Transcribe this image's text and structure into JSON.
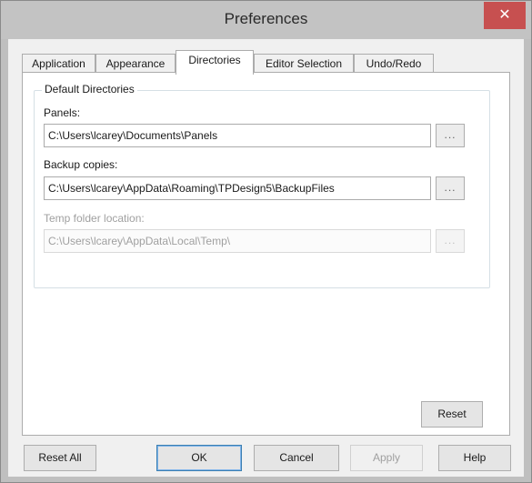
{
  "window": {
    "title": "Preferences"
  },
  "tabs": [
    {
      "label": "Application"
    },
    {
      "label": "Appearance"
    },
    {
      "label": "Directories"
    },
    {
      "label": "Editor Selection"
    },
    {
      "label": "Undo/Redo"
    }
  ],
  "active_tab": "Directories",
  "group": {
    "label": "Default Directories"
  },
  "fields": {
    "panels": {
      "label": "Panels:",
      "value": "C:\\Users\\lcarey\\Documents\\Panels",
      "browse": "..."
    },
    "backup": {
      "label": "Backup copies:",
      "value": "C:\\Users\\lcarey\\AppData\\Roaming\\TPDesign5\\BackupFiles",
      "browse": "..."
    },
    "temp": {
      "label": "Temp folder location:",
      "value": "C:\\Users\\lcarey\\AppData\\Local\\Temp\\",
      "browse": "...",
      "disabled": true
    }
  },
  "buttons": {
    "reset": "Reset",
    "reset_all": "Reset All",
    "ok": "OK",
    "cancel": "Cancel",
    "apply": "Apply",
    "help": "Help"
  },
  "icons": {
    "close": "close-icon"
  }
}
